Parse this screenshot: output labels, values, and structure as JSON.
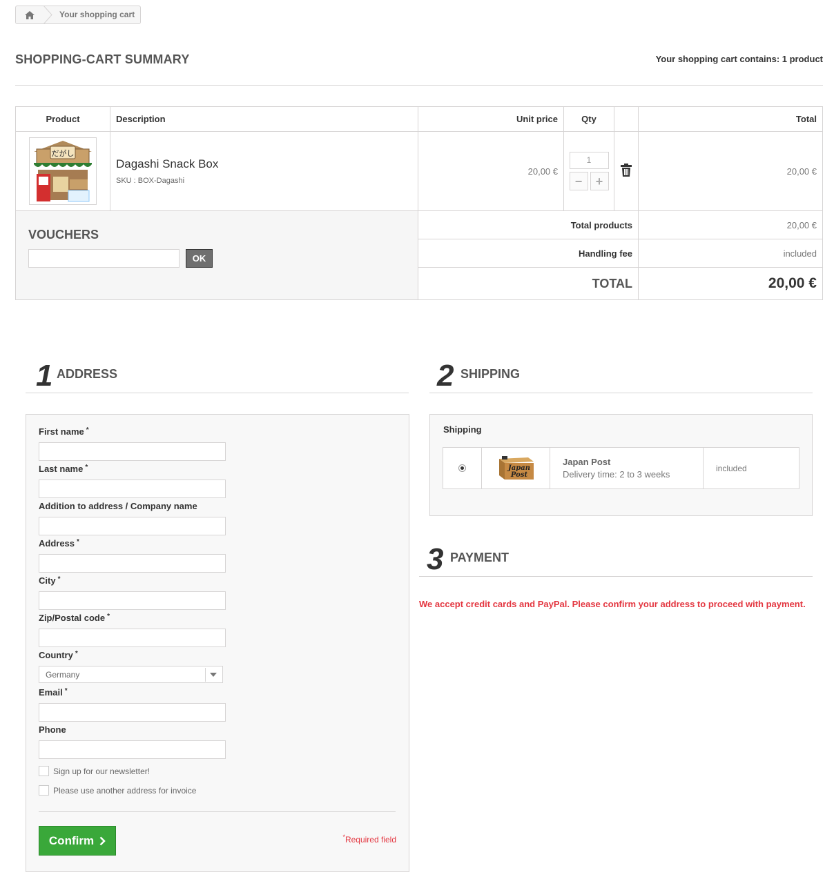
{
  "breadcrumb": {
    "home_icon": "home-icon",
    "current": "Your shopping cart"
  },
  "page": {
    "title": "SHOPPING-CART SUMMARY",
    "cart_count": "Your shopping cart contains: 1 product"
  },
  "cart": {
    "headers": {
      "product": "Product",
      "description": "Description",
      "unit_price": "Unit price",
      "qty": "Qty",
      "total": "Total"
    },
    "items": [
      {
        "name": "Dagashi Snack Box",
        "sku": "SKU : BOX-Dagashi",
        "unit_price": "20,00 €",
        "qty": "1",
        "total": "20,00 €",
        "image_text": "だがし"
      }
    ],
    "summary": {
      "total_products_label": "Total products",
      "total_products": "20,00 €",
      "handling_label": "Handling fee",
      "handling": "included",
      "total_label": "TOTAL",
      "total": "20,00 €"
    },
    "vouchers": {
      "title": "VOUCHERS",
      "ok_label": "OK",
      "value": ""
    }
  },
  "steps": {
    "address": {
      "num": "1",
      "title": "ADDRESS"
    },
    "shipping": {
      "num": "2",
      "title": "SHIPPING"
    },
    "payment": {
      "num": "3",
      "title": "PAYMENT"
    }
  },
  "address_form": {
    "fields": {
      "first_name": "First name",
      "last_name": "Last name",
      "company": "Addition to address / Company name",
      "address": "Address",
      "city": "City",
      "zip": "Zip/Postal code",
      "country": "Country",
      "email": "Email",
      "phone": "Phone"
    },
    "required_mark": "*",
    "country_value": "Germany",
    "newsletter": "Sign up for our newsletter!",
    "invoice": "Please use another address for invoice",
    "confirm": "Confirm",
    "required_note": "Required field"
  },
  "shipping": {
    "title": "Shipping",
    "carrier": {
      "name": "Japan Post",
      "delay": "Delivery time: 2 to 3 weeks",
      "price": "included",
      "logo_text": "Japan Post",
      "selected": true
    }
  },
  "payment": {
    "message": "We accept credit cards and PayPal. Please confirm your address to proceed with payment."
  },
  "colors": {
    "accent_green": "#3aa83a",
    "error_red": "#e3353f",
    "border": "#d6d4d4"
  }
}
